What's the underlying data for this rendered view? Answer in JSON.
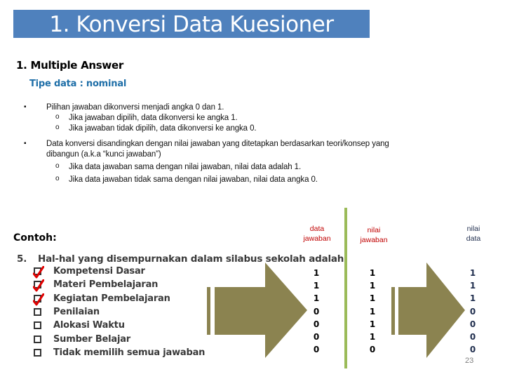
{
  "slide": {
    "title": "1. Konversi Data Kuesioner",
    "section_heading": "1. Multiple Answer",
    "data_type": "Tipe data : nominal",
    "rules": [
      {
        "bullet": "▪",
        "text": "Pilihan jawaban dikonversi menjadi angka 0 dan 1."
      },
      {
        "bullet": "o",
        "text": "Jika jawaban dipilih, data dikonversi ke angka 1."
      },
      {
        "bullet": "o",
        "text": "Jika jawaban tidak dipilih, data dikonversi ke angka 0."
      },
      {
        "bullet": "▪",
        "text": "Data konversi disandingkan dengan nilai jawaban yang ditetapkan berdasarkan teori/konsep yang"
      },
      {
        "bullet": "",
        "text": "dibangun (a.k.a “kunci jawaban”)"
      },
      {
        "bullet": "o",
        "text": "Jika data jawaban sama dengan nilai jawaban, nilai data adalah 1."
      },
      {
        "bullet": "o",
        "text": "Jika data jawaban tidak sama dengan nilai jawaban, nilai data angka 0."
      }
    ],
    "example_label": "Contoh:",
    "page_number": "23"
  },
  "question": {
    "number": "5.",
    "text": "Hal-hal yang disempurnakan dalam silabus sekolah adalah",
    "options": [
      {
        "label": "Kompetensi Dasar",
        "checked": true
      },
      {
        "label": "Materi Pembelajaran",
        "checked": true
      },
      {
        "label": "Kegiatan Pembelajaran",
        "checked": true
      },
      {
        "label": "Penilaian",
        "checked": false
      },
      {
        "label": "Alokasi Waktu",
        "checked": false
      },
      {
        "label": "Sumber Belajar",
        "checked": false
      },
      {
        "label": "Tidak memilih semua jawaban",
        "checked": false
      }
    ]
  },
  "columns": {
    "data_jawaban": {
      "header_line1": "data",
      "header_line2": "jawaban",
      "values": [
        "1",
        "1",
        "1",
        "0",
        "0",
        "0",
        "0"
      ]
    },
    "nilai_jawaban": {
      "header_line1": "nilai",
      "header_line2": "jawaban",
      "values": [
        "1",
        "1",
        "1",
        "1",
        "1",
        "1",
        "0"
      ]
    },
    "nilai_data": {
      "header_line1": "nilai",
      "header_line2": "data",
      "values": [
        "1",
        "1",
        "1",
        "0",
        "0",
        "0",
        "0"
      ]
    }
  },
  "colors": {
    "title_bg": "#4f81bd",
    "type_label": "#1f6fa8",
    "arrow": "#8b8350",
    "divider": "#9bbb59",
    "checkmark": "#e00000",
    "header_red": "#c00000",
    "nilai_data": "#1f2d4d"
  }
}
